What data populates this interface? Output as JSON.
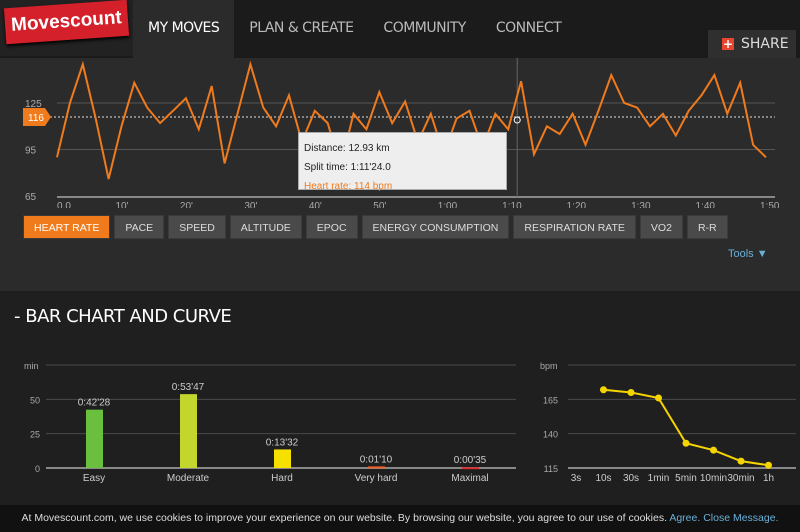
{
  "header": {
    "logo": "Movescount",
    "nav": [
      "MY MOVES",
      "PLAN & CREATE",
      "COMMUNITY",
      "CONNECT"
    ],
    "active": "MY MOVES",
    "share": "SHARE"
  },
  "hr_chart": {
    "type": "line",
    "color": "#f07b1d",
    "y_ticks": [
      65,
      95,
      125
    ],
    "ylim": [
      65,
      152
    ],
    "x_ticks": [
      "0.0",
      "10'",
      "20'",
      "30'",
      "40'",
      "50'",
      "1:00",
      "1:10",
      "1:20",
      "1:30",
      "1:40",
      "1:50"
    ],
    "xlim_min": [
      0,
      110
    ],
    "average_marker": "116",
    "minutes": [
      0,
      2,
      4,
      6,
      8,
      10,
      12,
      14,
      16,
      18,
      20,
      22,
      24,
      26,
      28,
      30,
      32,
      34,
      36,
      38,
      40,
      42,
      44,
      46,
      48,
      50,
      52,
      54,
      56,
      58,
      60,
      62,
      64,
      66,
      68,
      70,
      72,
      74,
      76,
      78,
      80,
      82,
      84,
      86,
      88,
      90,
      92,
      94,
      96,
      98,
      100,
      102,
      104,
      106,
      108,
      110
    ],
    "bpm": [
      90,
      125,
      150,
      115,
      76,
      110,
      138,
      122,
      112,
      120,
      128,
      108,
      136,
      86,
      118,
      150,
      122,
      110,
      130,
      100,
      120,
      112,
      84,
      118,
      108,
      132,
      112,
      126,
      100,
      118,
      92,
      115,
      120,
      96,
      118,
      108,
      139,
      92,
      110,
      105,
      118,
      98,
      120,
      143,
      125,
      122,
      110,
      118,
      104,
      120,
      130,
      143,
      118,
      138,
      98,
      90
    ],
    "cursor_minute": 71.4,
    "tooltip": {
      "distance": "Distance: 12.93 km",
      "split": "Split time: 1:11'24.0",
      "hr": "Heart rate: 114 bpm"
    }
  },
  "buttons": [
    "HEART RATE",
    "PACE",
    "SPEED",
    "ALTITUDE",
    "EPOC",
    "ENERGY CONSUMPTION",
    "RESPIRATION RATE",
    "VO2",
    "R-R"
  ],
  "active_button": "HEART RATE",
  "tools": "Tools ▼",
  "section_title": "-  BAR CHART AND CURVE",
  "chart_data": [
    {
      "type": "bar",
      "ylabel": "min",
      "y_ticks": [
        0,
        25,
        50
      ],
      "ylim": [
        0,
        75
      ],
      "categories": [
        "Easy",
        "Moderate",
        "Hard",
        "Very hard",
        "Maximal"
      ],
      "values": [
        42.47,
        53.78,
        13.53,
        1.17,
        0.58
      ],
      "labels": [
        "0:42'28",
        "0:53'47",
        "0:13'32",
        "0:01'10",
        "0:00'35"
      ],
      "colors": [
        "#6abf3f",
        "#c3d62e",
        "#f5e000",
        "#f0602a",
        "#d8302f"
      ]
    },
    {
      "type": "line",
      "ylabel": "bpm",
      "y_ticks": [
        115,
        140,
        165
      ],
      "ylim": [
        115,
        190
      ],
      "categories": [
        "3s",
        "10s",
        "30s",
        "1min",
        "5min",
        "10min30min",
        "1h"
      ],
      "x_ticks": [
        "3s",
        "10s",
        "30s",
        "1min",
        "5min",
        "10min",
        "30min",
        "1h"
      ],
      "points": [
        {
          "x": "10s",
          "y": 172
        },
        {
          "x": "30s",
          "y": 170
        },
        {
          "x": "1min",
          "y": 166
        },
        {
          "x": "5min",
          "y": 133
        },
        {
          "x": "10min",
          "y": 128
        },
        {
          "x": "30min",
          "y": 120
        },
        {
          "x": "1h",
          "y": 117
        }
      ],
      "color": "#f5d400"
    }
  ],
  "cookie": {
    "text": "At Movescount.com, we use cookies to improve your experience on our website. By browsing our website, you agree to our use of cookies.",
    "agree": "Agree.",
    "close": "Close Message."
  }
}
